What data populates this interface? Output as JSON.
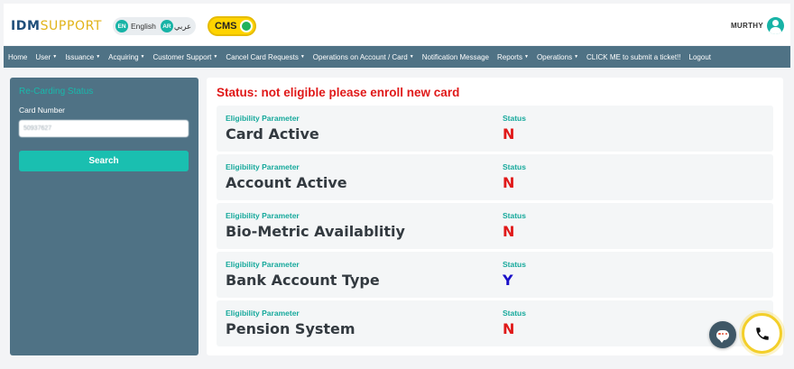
{
  "header": {
    "logo_idm": "IDM",
    "logo_support": "SUPPORT",
    "lang_en_code": "EN",
    "lang_en_label": "English",
    "lang_ar_code": "AR",
    "lang_ar_label": "عربي",
    "cms_label": "CMS",
    "user_name": "MURTHY"
  },
  "nav": [
    {
      "label": "Home",
      "dropdown": false
    },
    {
      "label": "User",
      "dropdown": true
    },
    {
      "label": "Issuance",
      "dropdown": true
    },
    {
      "label": "Acquiring",
      "dropdown": true
    },
    {
      "label": "Customer Support",
      "dropdown": true
    },
    {
      "label": "Cancel Card Requests",
      "dropdown": true
    },
    {
      "label": "Operations on Account / Card",
      "dropdown": true
    },
    {
      "label": "Notification Message",
      "dropdown": false
    },
    {
      "label": "Reports",
      "dropdown": true
    },
    {
      "label": "Operations",
      "dropdown": true
    },
    {
      "label": "CLICK ME to submit a ticket!!",
      "dropdown": false
    },
    {
      "label": "Logout",
      "dropdown": false
    }
  ],
  "sidebar": {
    "title": "Re-Carding Status",
    "card_number_label": "Card Number",
    "card_number_value": "50937627",
    "search_button": "Search"
  },
  "main": {
    "status_message": "Status: not eligible please enroll new card",
    "param_header": "Eligibility Parameter",
    "status_header": "Status",
    "rows": [
      {
        "parameter": "Card Active",
        "status": "N"
      },
      {
        "parameter": "Account Active",
        "status": "N"
      },
      {
        "parameter": "Bio-Metric Availablitiy",
        "status": "N"
      },
      {
        "parameter": "Bank Account Type",
        "status": "Y"
      },
      {
        "parameter": "Pension System",
        "status": "N"
      }
    ]
  },
  "colors": {
    "status_no": "#e01919",
    "status_yes": "#1a10c8",
    "accent": "#1abfb0",
    "panel": "#4f7285"
  },
  "icons": {
    "chat": "chat-icon",
    "call": "phone-icon",
    "avatar": "user-avatar-icon"
  }
}
